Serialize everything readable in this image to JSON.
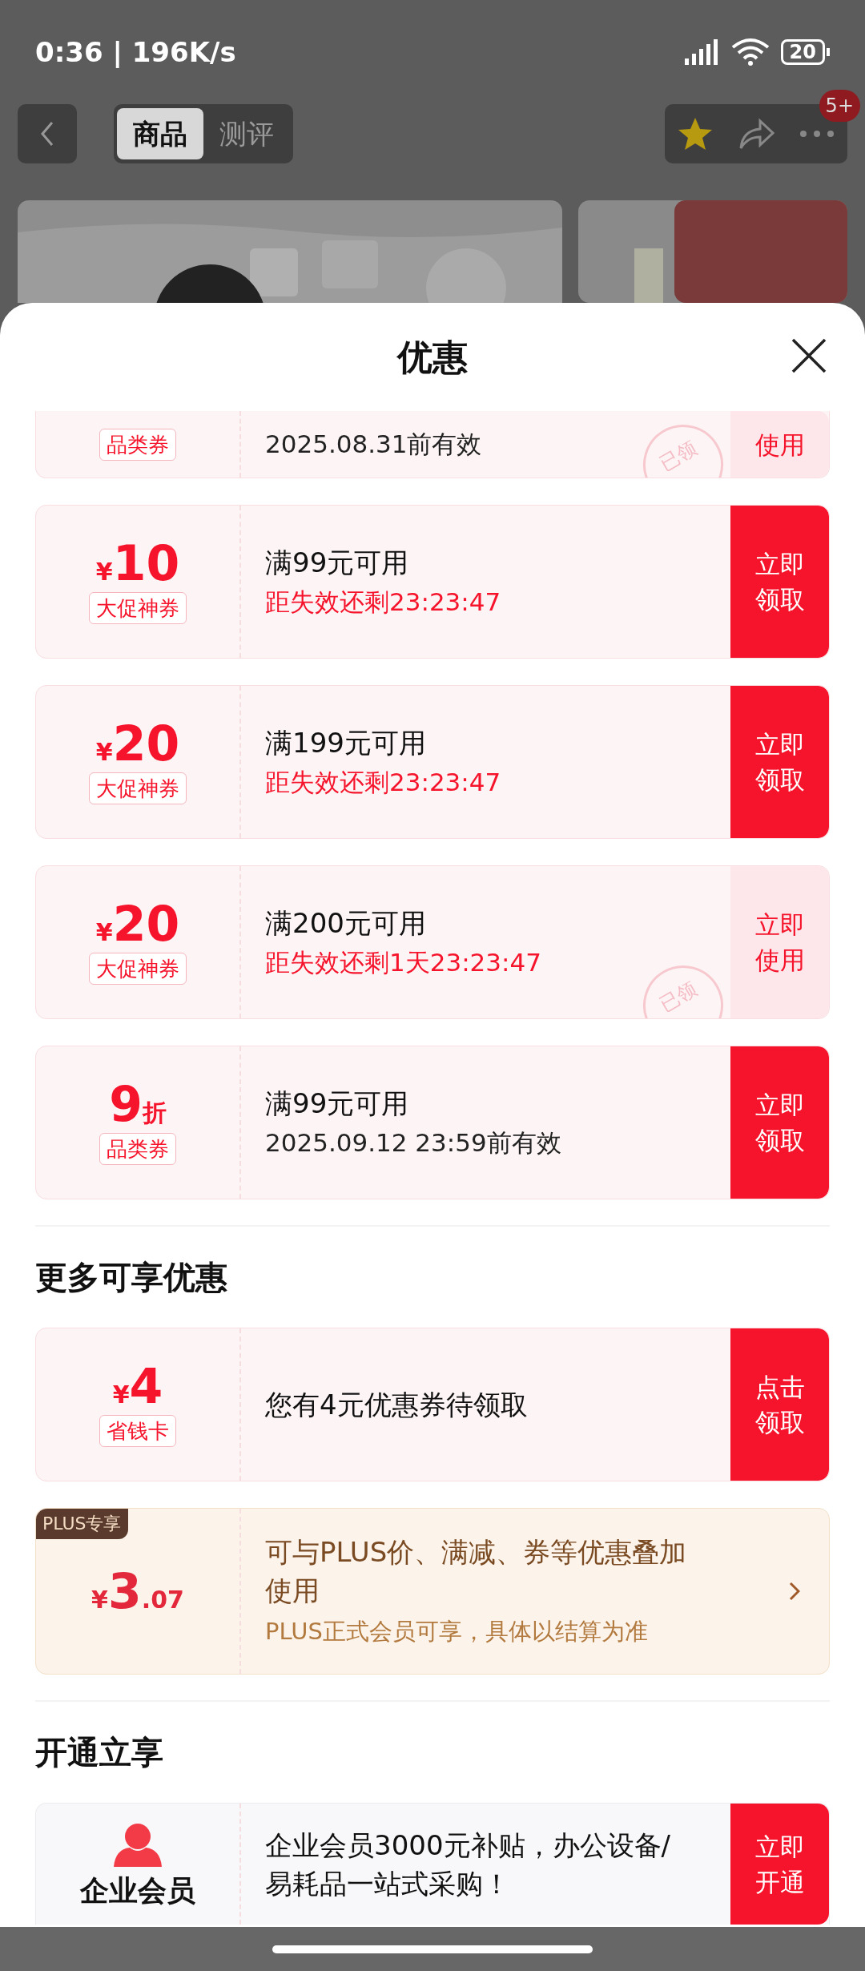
{
  "status_bar": {
    "time": "0:36 | 196K/s",
    "battery": "20"
  },
  "header": {
    "tabs": [
      {
        "label": "商品",
        "selected": true
      },
      {
        "label": "测评",
        "selected": false
      }
    ],
    "more_badge": "5+"
  },
  "sheet": {
    "title": "优惠",
    "coupons": [
      {
        "kind": "partial",
        "tag": "品类券",
        "line": "2025.08.31前有效",
        "button": "使用",
        "claimed": true,
        "stamp": "已领"
      },
      {
        "kind": "amount",
        "currency": "¥",
        "value": "10",
        "tag": "大促神券",
        "title": "满99元可用",
        "line": "距失效还剩23:23:47",
        "urgent": true,
        "button": "立即领取",
        "claimed": false
      },
      {
        "kind": "amount",
        "currency": "¥",
        "value": "20",
        "tag": "大促神券",
        "title": "满199元可用",
        "line": "距失效还剩23:23:47",
        "urgent": true,
        "button": "立即领取",
        "claimed": false
      },
      {
        "kind": "amount",
        "currency": "¥",
        "value": "20",
        "tag": "大促神券",
        "title": "满200元可用",
        "line": "距失效还剩1天23:23:47",
        "urgent": true,
        "button": "立即使用",
        "claimed": true,
        "stamp": "已领"
      },
      {
        "kind": "discount",
        "value": "9",
        "unit": "折",
        "tag": "品类券",
        "title": "满99元可用",
        "line": "2025.09.12 23:59前有效",
        "urgent": false,
        "button": "立即领取",
        "claimed": false
      }
    ],
    "sections": [
      {
        "heading": "更多可享优惠",
        "cards": [
          {
            "kind": "amount",
            "currency": "¥",
            "value": "4",
            "tag": "省钱卡",
            "title": "您有4元优惠券待领取",
            "button": "点击领取",
            "claimed": false
          },
          {
            "kind": "plus",
            "badge": "PLUS专享",
            "currency": "¥",
            "value": "3",
            "decimal": ".07",
            "title": "可与PLUS价、满减、券等优惠叠加使用",
            "line": "PLUS正式会员可享，具体以结算为准"
          }
        ]
      },
      {
        "heading": "开通立享",
        "cards": [
          {
            "kind": "member",
            "label": "企业会员",
            "title": "企业会员3000元补贴，办公设备/易耗品一站式采购！",
            "button": "立即开通",
            "claimed": false
          }
        ]
      }
    ]
  }
}
